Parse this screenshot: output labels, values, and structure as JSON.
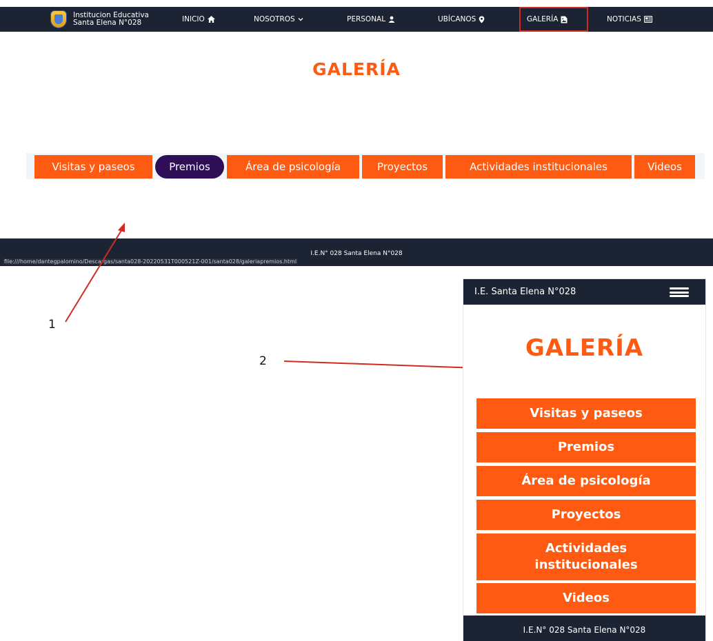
{
  "desktop": {
    "brand": {
      "line1": "Institucion Educativa",
      "line2": "Santa Elena N°028"
    },
    "nav": [
      {
        "label": "INICIO",
        "icon": "home-icon"
      },
      {
        "label": "NOSOTROS",
        "icon": "chevron-down-icon"
      },
      {
        "label": "PERSONAL",
        "icon": "user-icon"
      },
      {
        "label": "UBÍCANOS",
        "icon": "map-pin-icon"
      },
      {
        "label": "GALERÍA",
        "icon": "file-image-icon",
        "active": true
      },
      {
        "label": "NOTICIAS",
        "icon": "newspaper-icon"
      }
    ],
    "title": "GALERÍA",
    "tabs": [
      {
        "label": "Visitas y paseos"
      },
      {
        "label": "Premios",
        "active": true
      },
      {
        "label": "Área de psicología"
      },
      {
        "label": "Proyectos"
      },
      {
        "label": "Actividades institucionales"
      },
      {
        "label": "Videos"
      }
    ],
    "footer_text": "I.E.N° 028 Santa Elena N°028",
    "status_url": "file:///home/dantegpalomino/Descargas/santa028-20220531T000521Z-001/santa028/galeriapremios.html"
  },
  "annotations": {
    "label_1": "1",
    "label_2": "2",
    "arrow_color": "#d12a1e"
  },
  "mobile": {
    "brand": "I.E. Santa Elena N°028",
    "menu_icon": "hamburger-icon",
    "title": "GALERÍA",
    "buttons": [
      {
        "label": "Visitas y paseos"
      },
      {
        "label": "Premios"
      },
      {
        "label": "Área de psicología"
      },
      {
        "label": "Proyectos"
      },
      {
        "label": "Actividades institucionales"
      },
      {
        "label": "Videos"
      }
    ],
    "footer_text": "I.E.N° 028 Santa Elena N°028"
  },
  "colors": {
    "navbar": "#1c2433",
    "accent": "#ff5a12",
    "active_tab": "#2e0f57",
    "tab_strip": "#f1f6fb"
  }
}
